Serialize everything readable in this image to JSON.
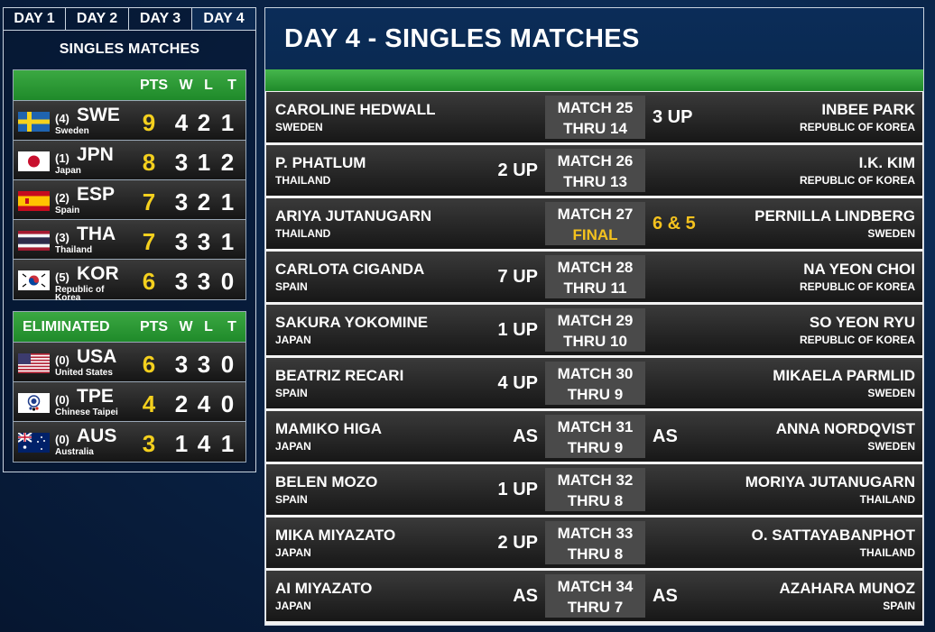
{
  "tabs": [
    "DAY 1",
    "DAY 2",
    "DAY 3",
    "DAY 4"
  ],
  "active_tab": 3,
  "left_panel": {
    "title": "SINGLES MATCHES",
    "standings": {
      "headers": {
        "label": "",
        "pts": "PTS",
        "w": "W",
        "l": "L",
        "t": "T"
      },
      "rows": [
        {
          "seed": "(4)",
          "code": "SWE",
          "name": "Sweden",
          "flag": "sweden-flag-icon",
          "pts": "9",
          "w": "4",
          "l": "2",
          "t": "1"
        },
        {
          "seed": "(1)",
          "code": "JPN",
          "name": "Japan",
          "flag": "japan-flag-icon",
          "pts": "8",
          "w": "3",
          "l": "1",
          "t": "2"
        },
        {
          "seed": "(2)",
          "code": "ESP",
          "name": "Spain",
          "flag": "spain-flag-icon",
          "pts": "7",
          "w": "3",
          "l": "2",
          "t": "1"
        },
        {
          "seed": "(3)",
          "code": "THA",
          "name": "Thailand",
          "flag": "thailand-flag-icon",
          "pts": "7",
          "w": "3",
          "l": "3",
          "t": "1"
        },
        {
          "seed": "(5)",
          "code": "KOR",
          "name": "Republic of Korea",
          "flag": "korea-flag-icon",
          "pts": "6",
          "w": "3",
          "l": "3",
          "t": "0"
        }
      ]
    },
    "eliminated": {
      "headers": {
        "label": "ELIMINATED",
        "pts": "PTS",
        "w": "W",
        "l": "L",
        "t": "T"
      },
      "rows": [
        {
          "seed": "(0)",
          "code": "USA",
          "name": "United States",
          "flag": "usa-flag-icon",
          "pts": "6",
          "w": "3",
          "l": "3",
          "t": "0"
        },
        {
          "seed": "(0)",
          "code": "TPE",
          "name": "Chinese Taipei",
          "flag": "chinese-taipei-flag-icon",
          "pts": "4",
          "w": "2",
          "l": "4",
          "t": "0"
        },
        {
          "seed": "(0)",
          "code": "AUS",
          "name": "Australia",
          "flag": "australia-flag-icon",
          "pts": "3",
          "w": "1",
          "l": "4",
          "t": "1"
        }
      ]
    }
  },
  "main": {
    "title": "DAY 4 - SINGLES MATCHES",
    "matches": [
      {
        "p1": "CAROLINE HEDWALL",
        "p1_country": "SWEDEN",
        "p1_score": "",
        "match": "MATCH 25",
        "status": "THRU 14",
        "status_final": false,
        "p2_score": "3 UP",
        "p2_gold": false,
        "p2": "INBEE PARK",
        "p2_country": "REPUBLIC OF KOREA"
      },
      {
        "p1": "P. PHATLUM",
        "p1_country": "THAILAND",
        "p1_score": "2 UP",
        "match": "MATCH 26",
        "status": "THRU 13",
        "status_final": false,
        "p2_score": "",
        "p2_gold": false,
        "p2": "I.K. KIM",
        "p2_country": "REPUBLIC OF KOREA"
      },
      {
        "p1": "ARIYA JUTANUGARN",
        "p1_country": "THAILAND",
        "p1_score": "",
        "match": "MATCH 27",
        "status": "FINAL",
        "status_final": true,
        "p2_score": "6 & 5",
        "p2_gold": true,
        "p2": "PERNILLA LINDBERG",
        "p2_country": "SWEDEN"
      },
      {
        "p1": "CARLOTA CIGANDA",
        "p1_country": "SPAIN",
        "p1_score": "7 UP",
        "match": "MATCH 28",
        "status": "THRU 11",
        "status_final": false,
        "p2_score": "",
        "p2_gold": false,
        "p2": "NA YEON CHOI",
        "p2_country": "REPUBLIC OF KOREA"
      },
      {
        "p1": "SAKURA YOKOMINE",
        "p1_country": "JAPAN",
        "p1_score": "1 UP",
        "match": "MATCH 29",
        "status": "THRU 10",
        "status_final": false,
        "p2_score": "",
        "p2_gold": false,
        "p2": "SO YEON RYU",
        "p2_country": "REPUBLIC OF KOREA"
      },
      {
        "p1": "BEATRIZ RECARI",
        "p1_country": "SPAIN",
        "p1_score": "4 UP",
        "match": "MATCH 30",
        "status": "THRU 9",
        "status_final": false,
        "p2_score": "",
        "p2_gold": false,
        "p2": "MIKAELA PARMLID",
        "p2_country": "SWEDEN"
      },
      {
        "p1": "MAMIKO HIGA",
        "p1_country": "JAPAN",
        "p1_score": "AS",
        "match": "MATCH 31",
        "status": "THRU 9",
        "status_final": false,
        "p2_score": "AS",
        "p2_gold": false,
        "p2": "ANNA NORDQVIST",
        "p2_country": "SWEDEN"
      },
      {
        "p1": "BELEN MOZO",
        "p1_country": "SPAIN",
        "p1_score": "1 UP",
        "match": "MATCH 32",
        "status": "THRU 8",
        "status_final": false,
        "p2_score": "",
        "p2_gold": false,
        "p2": "MORIYA JUTANUGARN",
        "p2_country": "THAILAND"
      },
      {
        "p1": "MIKA MIYAZATO",
        "p1_country": "JAPAN",
        "p1_score": "2 UP",
        "match": "MATCH 33",
        "status": "THRU 8",
        "status_final": false,
        "p2_score": "",
        "p2_gold": false,
        "p2": "O. SATTAYABANPHOT",
        "p2_country": "THAILAND"
      },
      {
        "p1": "AI MIYAZATO",
        "p1_country": "JAPAN",
        "p1_score": "AS",
        "match": "MATCH 34",
        "status": "THRU 7",
        "status_final": false,
        "p2_score": "AS",
        "p2_gold": false,
        "p2": "AZAHARA MUNOZ",
        "p2_country": "SPAIN"
      }
    ]
  },
  "colors": {
    "gold": "#f4d01e",
    "green": "#2a9c35",
    "navy": "#0a2a52"
  }
}
